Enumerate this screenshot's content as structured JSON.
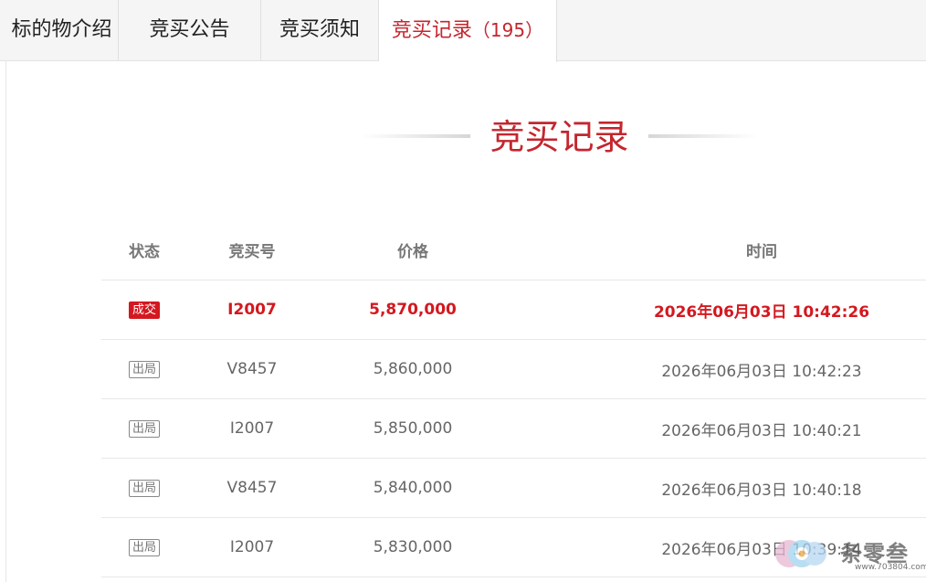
{
  "tabs": [
    {
      "label": "标的物介绍"
    },
    {
      "label": "竞买公告"
    },
    {
      "label": "竞买须知"
    },
    {
      "label": "竞买记录",
      "count": "（195）"
    }
  ],
  "active_tab_index": 3,
  "heading": "竞买记录",
  "table": {
    "headers": {
      "status": "状态",
      "bidder": "竞买号",
      "price": "价格",
      "time": "时间"
    },
    "rows": [
      {
        "status": "成交",
        "status_type": "win",
        "bidder": "I2007",
        "price": "5,870,000",
        "time": "2026年06月03日 10:42:26"
      },
      {
        "status": "出局",
        "status_type": "out",
        "bidder": "V8457",
        "price": "5,860,000",
        "time": "2026年06月03日 10:42:23"
      },
      {
        "status": "出局",
        "status_type": "out",
        "bidder": "I2007",
        "price": "5,850,000",
        "time": "2026年06月03日 10:40:21"
      },
      {
        "status": "出局",
        "status_type": "out",
        "bidder": "V8457",
        "price": "5,840,000",
        "time": "2026年06月03日 10:40:18"
      },
      {
        "status": "出局",
        "status_type": "out",
        "bidder": "I2007",
        "price": "5,830,000",
        "time": "2026年06月03日 10:39:14"
      }
    ]
  },
  "watermark": {
    "name": "条零叁",
    "url": "www.703804.com"
  },
  "colors": {
    "accent": "#c4262e",
    "win": "#d4181f",
    "text": "#666666"
  }
}
